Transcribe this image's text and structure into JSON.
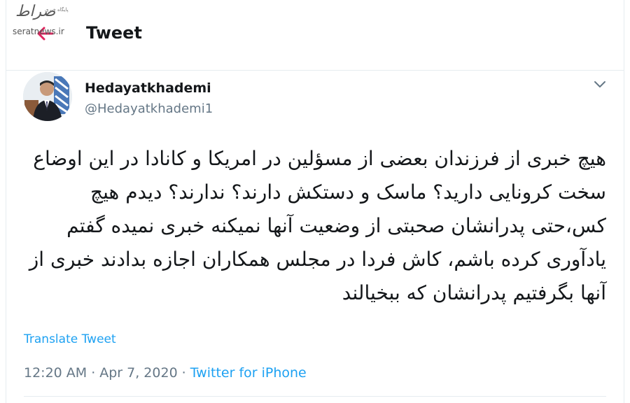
{
  "watermark": {
    "script_text": "صراط",
    "small_text": "پایگاه خبری",
    "site": "seratnews.ir"
  },
  "header": {
    "back_icon": "arrow-left-icon",
    "title": "Tweet"
  },
  "author": {
    "display_name": "Hedayatkhademi",
    "handle": "@Hedayatkhademi1",
    "menu_icon": "chevron-down-icon"
  },
  "tweet": {
    "text": "هیچ خبری از فرزندان بعضی از مسؤلین در امریکا و کانادا در این اوضاع سخت کرونایی دارید؟ ماسک و دستکش دارند؟ ندارند؟ دیدم هیچ کس،حتی پدرانشان صحبتی از وضعیت آنها نمیکنه خبری نمیده گفتم یادآوری کرده باشم، کاش فردا در مجلس همکاران اجازه بدادند خبری از آنها بگرفتیم پدرانشان که ببخیالند"
  },
  "actions": {
    "translate_label": "Translate Tweet"
  },
  "meta": {
    "time": "12:20 AM",
    "separator": "·",
    "date": "Apr 7, 2020",
    "source": "Twitter for iPhone"
  },
  "colors": {
    "accent": "#1da1f2",
    "text": "#14171a",
    "muted": "#657786",
    "border": "#e6ecf0"
  }
}
